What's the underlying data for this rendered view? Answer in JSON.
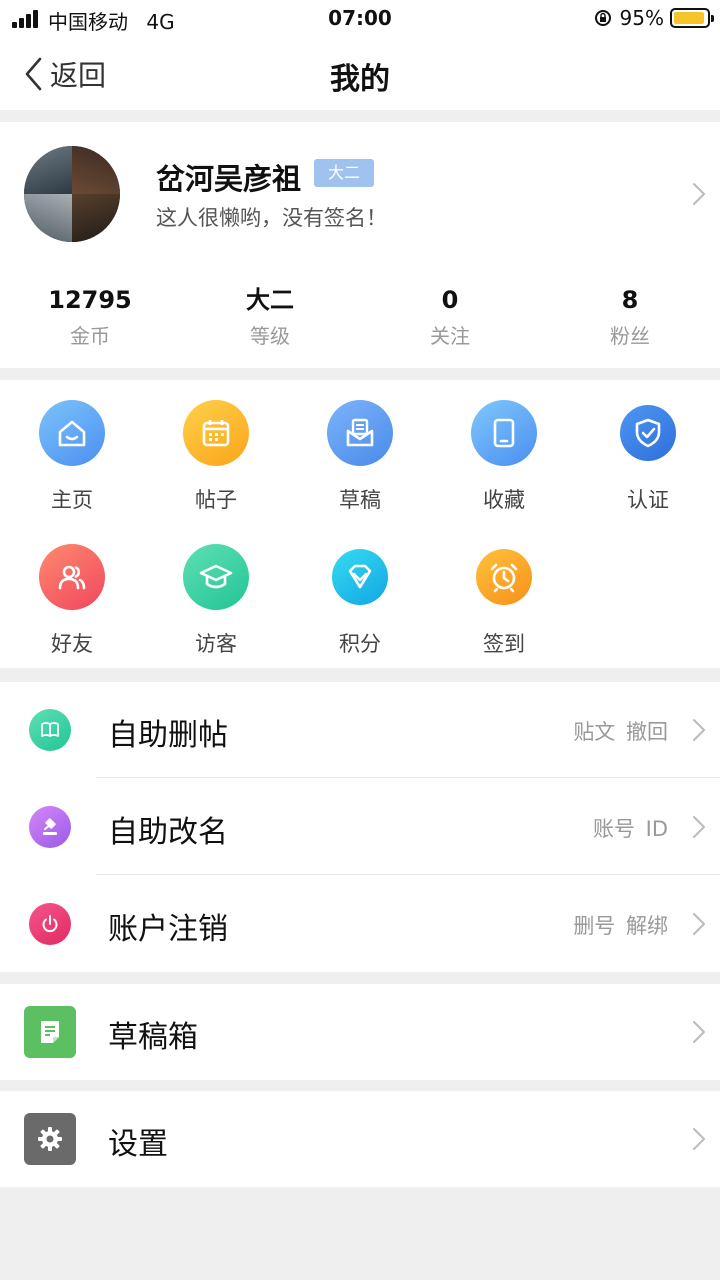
{
  "status_bar": {
    "carrier": "中国移动",
    "network": "4G",
    "time": "07:00",
    "battery_percent": "95%",
    "battery_level": 0.95
  },
  "nav": {
    "back_label": "返回",
    "title": "我的"
  },
  "profile": {
    "name": "岔河吴彦祖",
    "level_badge": "大二",
    "signature": "这人很懒哟，没有签名！",
    "stats": [
      {
        "value": "12795",
        "label": "金币"
      },
      {
        "value": "大二",
        "label": "等级"
      },
      {
        "value": "0",
        "label": "关注"
      },
      {
        "value": "8",
        "label": "粉丝"
      }
    ]
  },
  "grid": [
    {
      "label": "主页",
      "icon": "home-icon",
      "color": "#5aa2f4"
    },
    {
      "label": "帖子",
      "icon": "calendar-icon",
      "color": "#fbb523"
    },
    {
      "label": "草稿",
      "icon": "envelope-icon",
      "color": "#5b9ef0"
    },
    {
      "label": "收藏",
      "icon": "tablet-icon",
      "color": "#5aa6f6"
    },
    {
      "label": "认证",
      "icon": "shield-check-icon",
      "color": "#3c83e6"
    },
    {
      "label": "好友",
      "icon": "friends-icon",
      "color": "#f4646a"
    },
    {
      "label": "访客",
      "icon": "graduation-cap-icon",
      "color": "#3bd2a1"
    },
    {
      "label": "积分",
      "icon": "diamond-icon",
      "color": "#1cc7e4"
    },
    {
      "label": "签到",
      "icon": "alarm-clock-icon",
      "color": "#f9a21e"
    }
  ],
  "menu_main": [
    {
      "label": "自助删帖",
      "hint": "贴文 撤回",
      "icon": "book-icon",
      "color": "#39d0a6"
    },
    {
      "label": "自助改名",
      "hint": "账号 ID",
      "icon": "gavel-icon",
      "color": "#b86ef0"
    },
    {
      "label": "账户注销",
      "hint": "删号 解绑",
      "icon": "power-icon",
      "color": "#ee3f7a"
    }
  ],
  "menu_drafts": {
    "label": "草稿箱",
    "icon": "document-icon",
    "color": "#5cc062"
  },
  "menu_settings": {
    "label": "设置",
    "icon": "gear-icon",
    "color": "#6a6a6a"
  }
}
